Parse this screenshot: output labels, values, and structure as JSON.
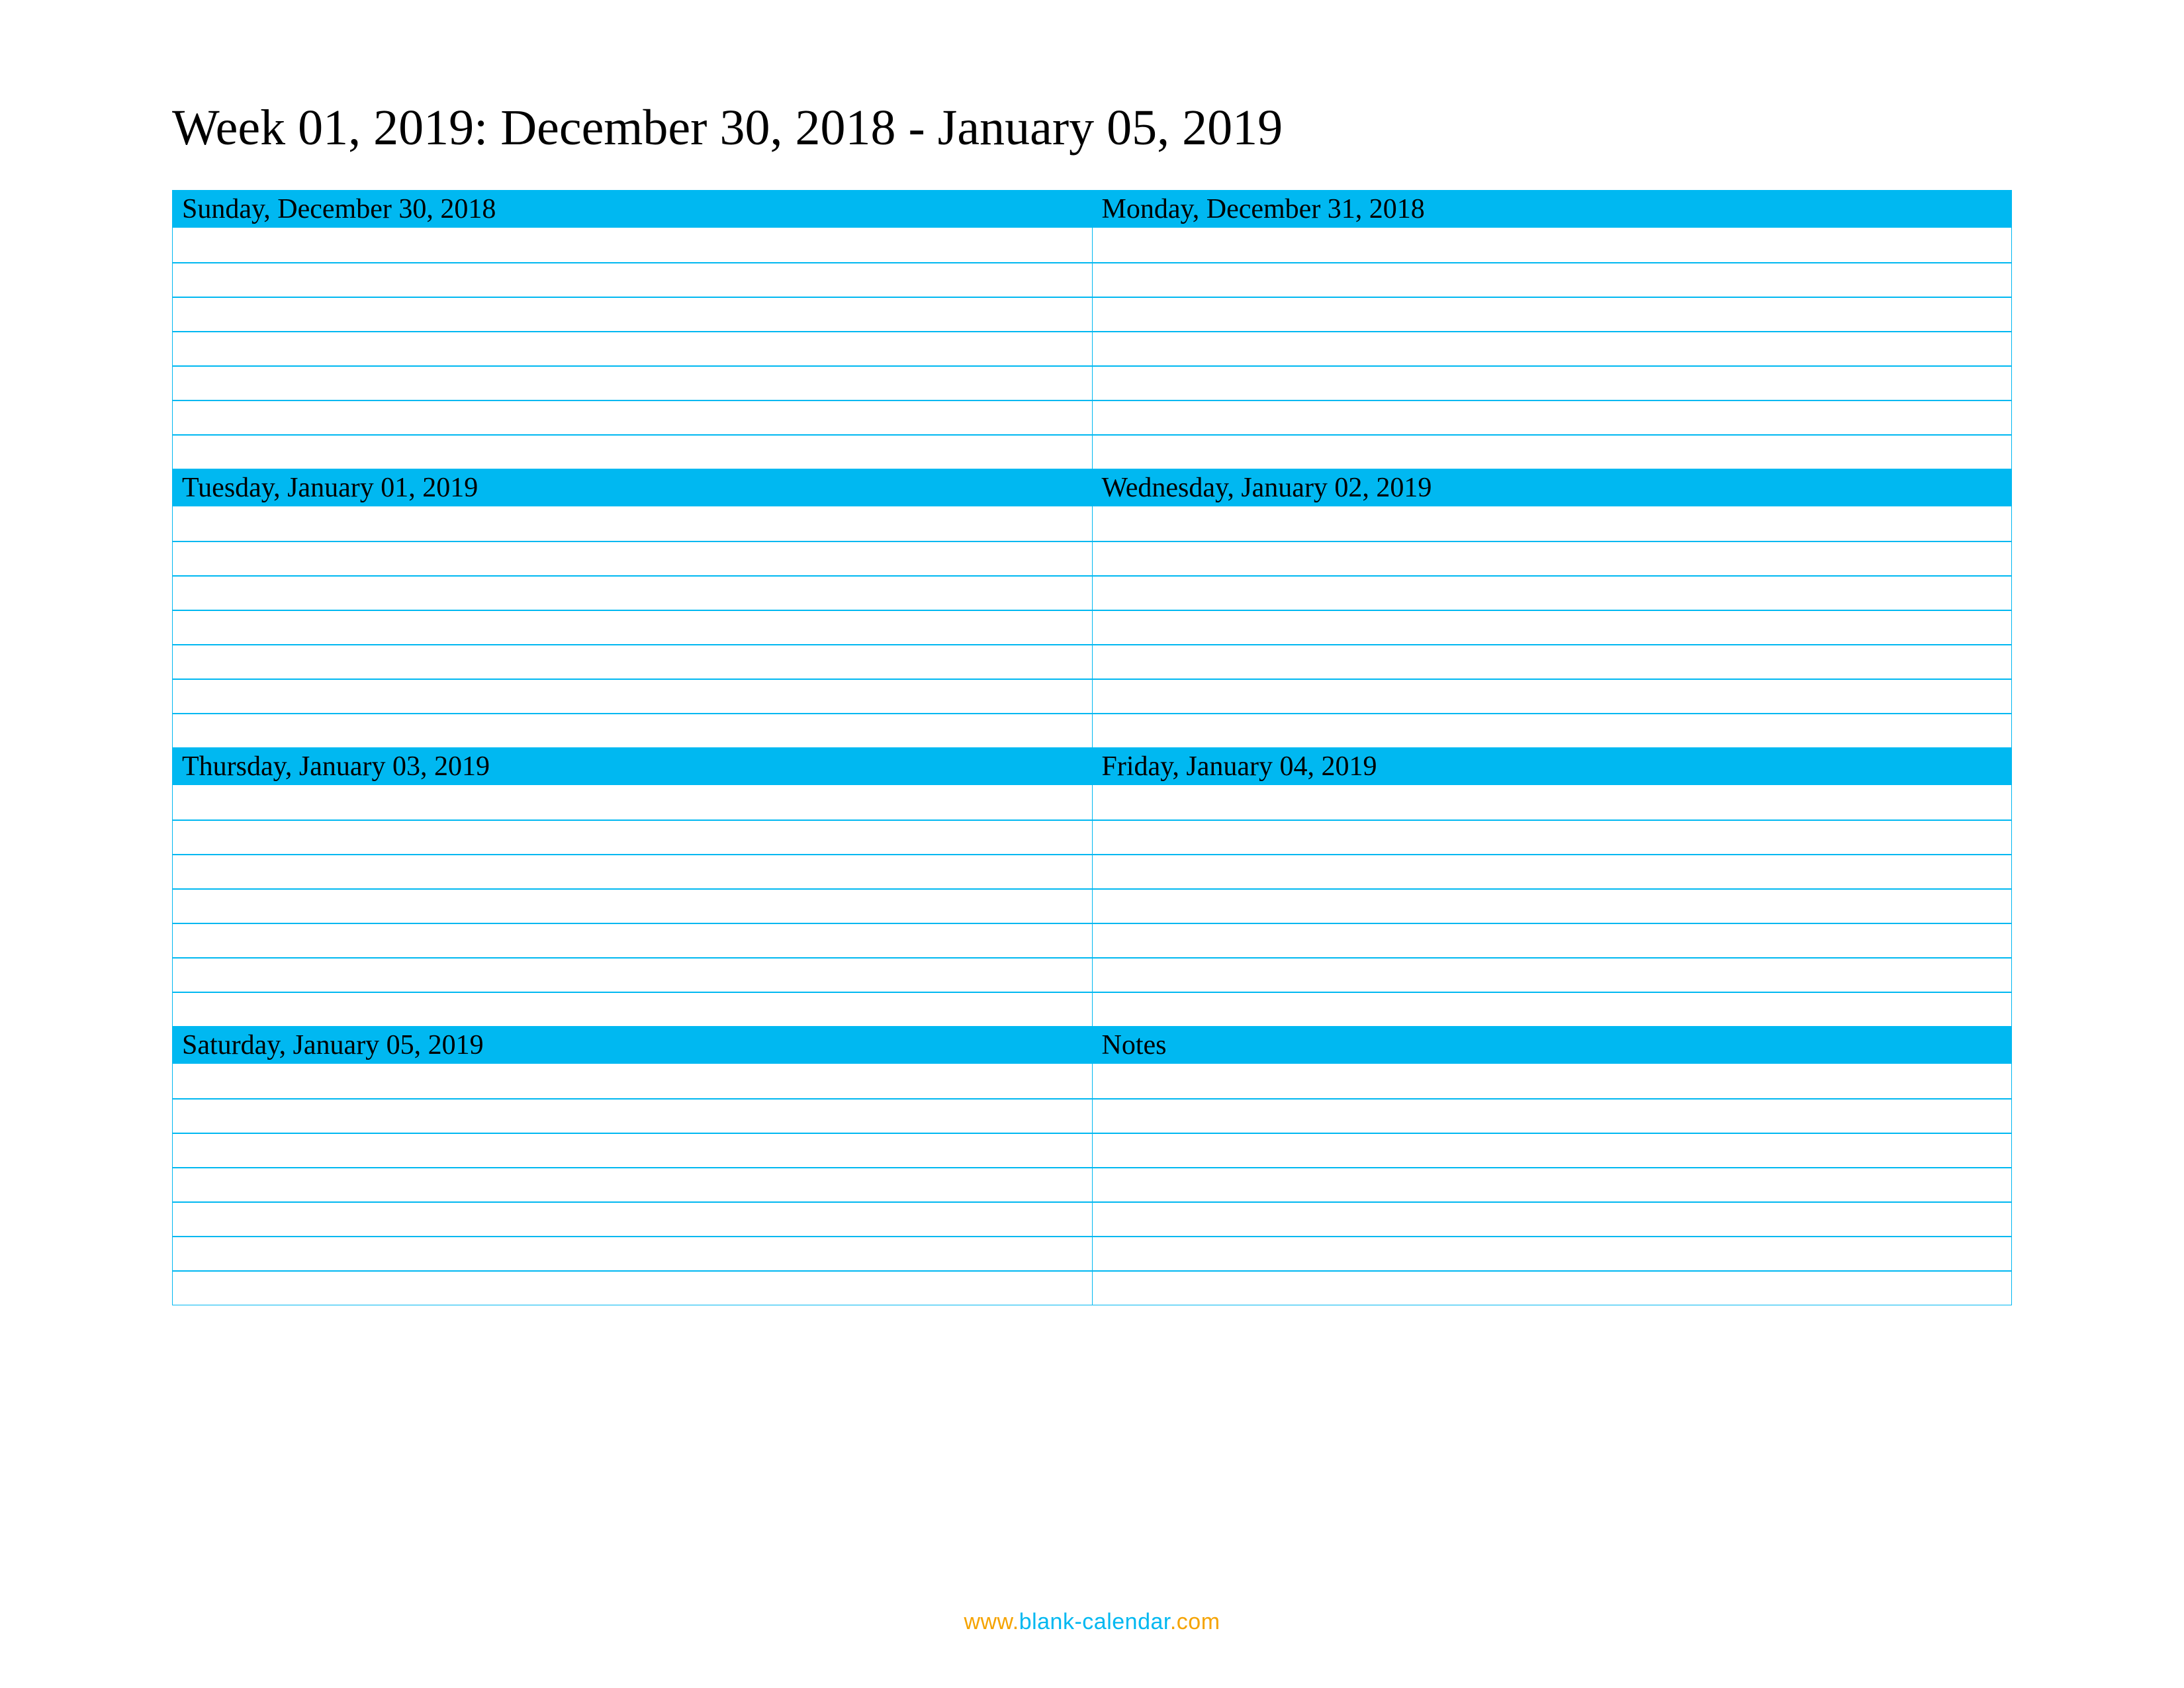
{
  "title": "Week 01, 2019: December 30, 2018 - January 05, 2019",
  "slots": [
    {
      "left": "Sunday, December 30, 2018",
      "right": "Monday, December 31, 2018"
    },
    {
      "left": "Tuesday, January 01, 2019",
      "right": "Wednesday, January 02, 2019"
    },
    {
      "left": "Thursday, January 03, 2019",
      "right": "Friday, January 04, 2019"
    },
    {
      "left": "Saturday, January 05, 2019",
      "right": "Notes"
    }
  ],
  "lines_per_slot": 7,
  "footer": {
    "www": "www.",
    "domain": "blank-calendar",
    "com": ".com"
  },
  "colors": {
    "accent": "#00b8f1",
    "footer_orange": "#f5a300"
  }
}
